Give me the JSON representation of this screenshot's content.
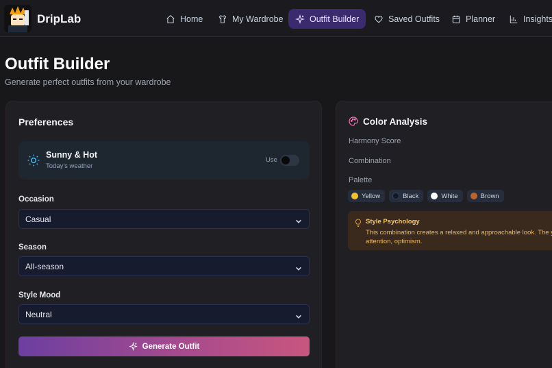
{
  "app": {
    "brand": "DripLab"
  },
  "nav": {
    "items": [
      {
        "label": "Home",
        "icon": "home-icon"
      },
      {
        "label": "My Wardrobe",
        "icon": "shirt-icon"
      },
      {
        "label": "Outfit Builder",
        "icon": "sparkles-icon",
        "active": true
      },
      {
        "label": "Saved Outfits",
        "icon": "heart-icon"
      },
      {
        "label": "Planner",
        "icon": "calendar-icon"
      },
      {
        "label": "Insights",
        "icon": "bar-chart-icon"
      }
    ]
  },
  "header": {
    "title": "Outfit Builder",
    "subtitle": "Generate perfect outfits from your wardrobe"
  },
  "preferences": {
    "title": "Preferences",
    "weather": {
      "condition": "Sunny & Hot",
      "sub": "Today's weather",
      "use_label": "Use",
      "use_enabled": false
    },
    "occasion": {
      "label": "Occasion",
      "value": "Casual"
    },
    "season": {
      "label": "Season",
      "value": "All-season"
    },
    "style_mood": {
      "label": "Style Mood",
      "value": "Neutral"
    },
    "generate_label": "Generate Outfit"
  },
  "color_analysis": {
    "title": "Color Analysis",
    "harmony_label": "Harmony Score",
    "combination_label": "Combination",
    "palette_label": "Palette",
    "palette": [
      {
        "name": "Yellow",
        "color": "#f2c12e"
      },
      {
        "name": "Black",
        "color": "#0f172a"
      },
      {
        "name": "White",
        "color": "#ffffff"
      },
      {
        "name": "Brown",
        "color": "#b7652a"
      }
    ],
    "psychology": {
      "title": "Style Psychology",
      "line1": "This combination creates a relaxed and approachable look. The ye",
      "line2": "attention, optimism."
    }
  },
  "colors": {
    "accent": "#3b2a6e",
    "background": "#18181b",
    "card": "#1f1f24"
  }
}
